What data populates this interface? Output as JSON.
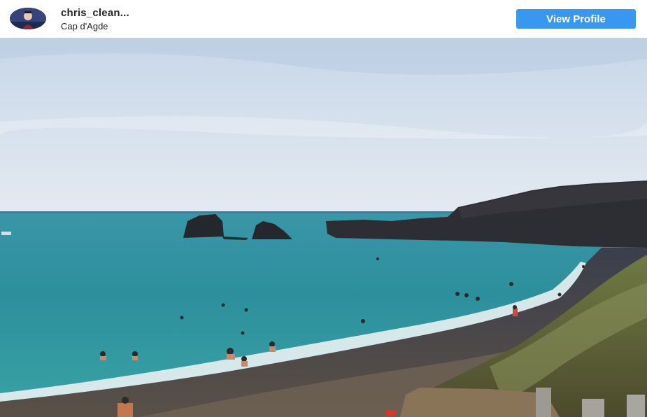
{
  "header": {
    "username": "chris_clean...",
    "location": "Cap d'Agde",
    "view_profile_label": "View Profile",
    "avatar_icon": "user-avatar-icon"
  },
  "post": {
    "image_description_icon": "beach-photo"
  },
  "colors": {
    "accent": "#3897f0",
    "text": "#262626",
    "background": "#ffffff"
  }
}
